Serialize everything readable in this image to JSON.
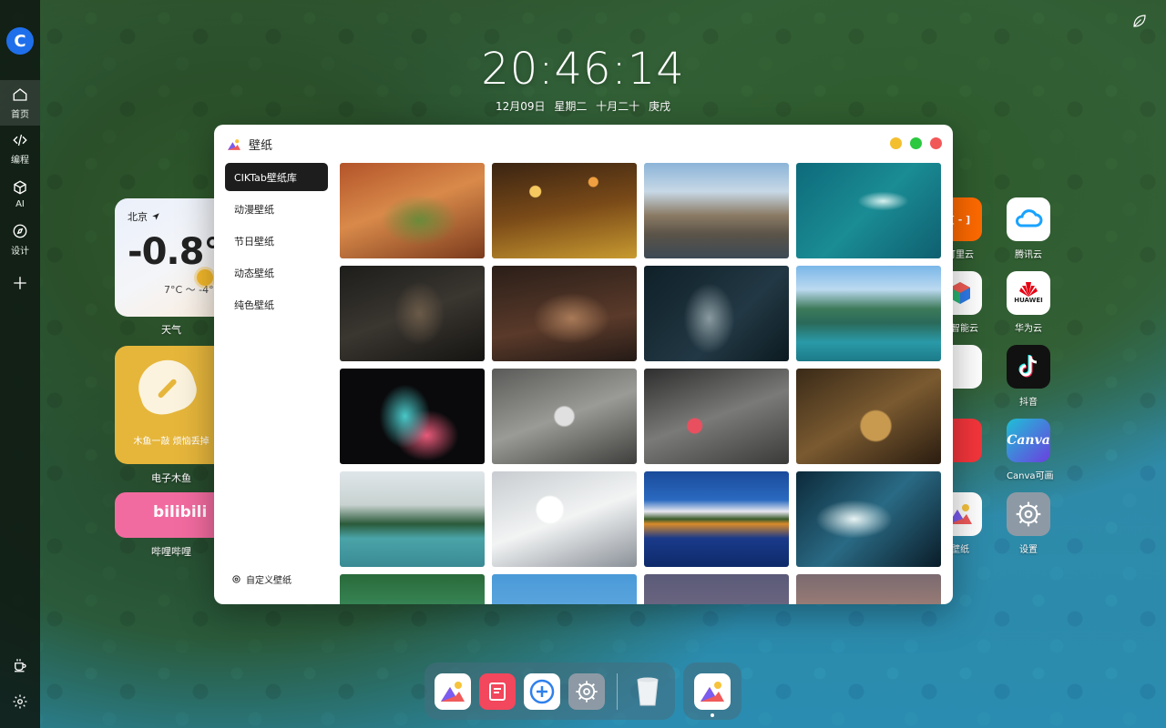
{
  "sidebar": {
    "logo": "C",
    "items": [
      {
        "label": "首页",
        "icon": "home-icon",
        "active": true
      },
      {
        "label": "编程",
        "icon": "code-icon",
        "active": false
      },
      {
        "label": "AI",
        "icon": "cube-icon",
        "active": false
      },
      {
        "label": "设计",
        "icon": "compass-icon",
        "active": false
      }
    ]
  },
  "clock": {
    "time": "20:46:14"
  },
  "date": {
    "date": "12月09日",
    "weekday": "星期二",
    "lunar": "十月二十",
    "ganzhi": "庚戌"
  },
  "widgets": {
    "weather": {
      "city": "北京",
      "temp": "-0.8°",
      "range": "7°C ～ -4°C",
      "caption": "天气"
    },
    "muyu": {
      "text": "木鱼一敲 烦恼丢掉",
      "caption": "电子木鱼"
    },
    "bilibili": {
      "logo": "bilibili",
      "caption": "哔哩哔哩"
    }
  },
  "apps": [
    {
      "label": "阿里云",
      "visible_label": "可里云",
      "color": "#ff6a00",
      "icon": "aliyun-icon"
    },
    {
      "label": "腾讯云",
      "color": "#ffffff",
      "icon": "tencent-cloud-icon"
    },
    {
      "label": "百度智能云",
      "visible_label": "度智能云",
      "color": "#ffffff",
      "icon": "baidu-cloud-icon"
    },
    {
      "label": "华为云",
      "color": "#ffffff",
      "icon": "huawei-icon",
      "text": "HUAWEI"
    },
    {
      "label": "抖音",
      "color": "#111111",
      "icon": "douyin-icon"
    },
    {
      "label": "Canva可画",
      "color": "#1ec0d6",
      "icon": "canva-icon",
      "text": "Canva"
    },
    {
      "label": "壁纸",
      "visible_label": "壁纸",
      "color": "#ffffff",
      "icon": "wallpaper-icon"
    },
    {
      "label": "设置",
      "color": "#8d9aa5",
      "icon": "settings-icon"
    }
  ],
  "wallpaper_window": {
    "title": "壁纸",
    "menu": [
      "CIKTab壁纸库",
      "动漫壁纸",
      "节日壁纸",
      "动态壁纸",
      "纯色壁纸"
    ],
    "active_menu": "CIKTab壁纸库",
    "custom_label": "自定义壁纸",
    "traffic": {
      "minimize": "#f4bf2f",
      "maximize": "#2bc840",
      "close": "#f25757"
    }
  },
  "dock": {
    "apps": [
      "wallpaper-icon",
      "note-icon",
      "add-icon",
      "settings-icon",
      "trash-icon"
    ],
    "running": "wallpaper-icon"
  }
}
